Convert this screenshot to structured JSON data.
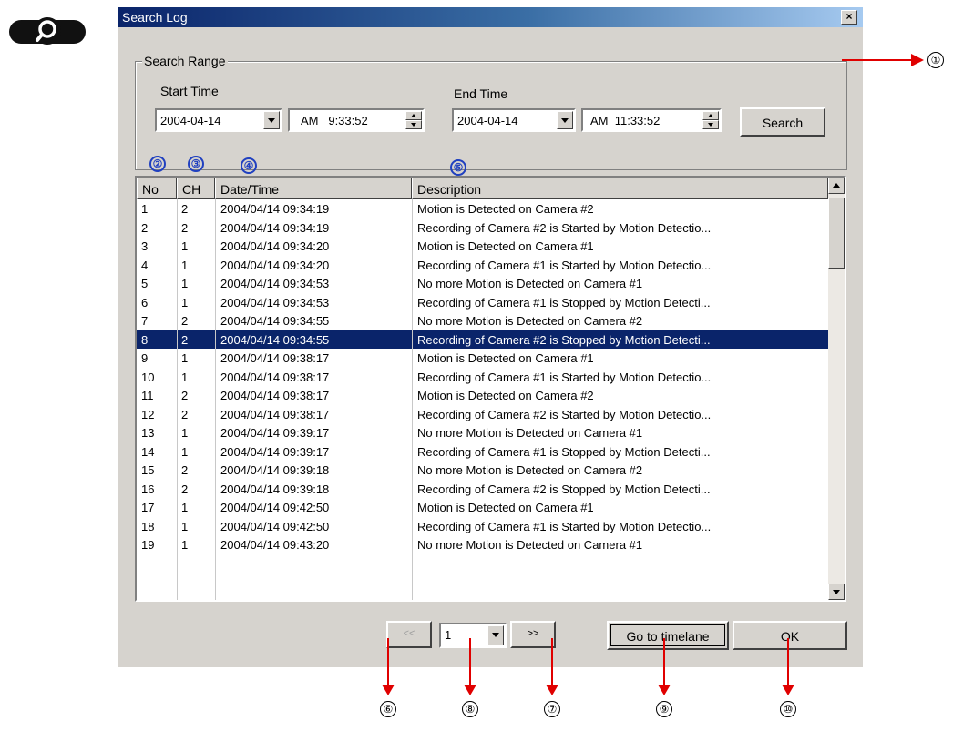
{
  "window": {
    "title": "Search Log",
    "close_glyph": "×"
  },
  "search_range": {
    "group_label": "Search Range",
    "start_label": "Start Time",
    "end_label": "End Time",
    "start_date": "2004-04-14",
    "start_time": "AM   9:33:52",
    "end_date": "2004-04-14",
    "end_time": "AM  11:33:52",
    "search_label": "Search"
  },
  "columns": [
    "No",
    "CH",
    "Date/Time",
    "Description"
  ],
  "rows": [
    [
      "1",
      "2",
      "2004/04/14 09:34:19",
      "Motion is Detected on Camera #2"
    ],
    [
      "2",
      "2",
      "2004/04/14 09:34:19",
      "Recording of Camera #2 is Started by Motion Detectio..."
    ],
    [
      "3",
      "1",
      "2004/04/14 09:34:20",
      "Motion is Detected on Camera #1"
    ],
    [
      "4",
      "1",
      "2004/04/14 09:34:20",
      "Recording of Camera #1 is Started by Motion Detectio..."
    ],
    [
      "5",
      "1",
      "2004/04/14 09:34:53",
      "No more Motion is Detected on Camera #1"
    ],
    [
      "6",
      "1",
      "2004/04/14 09:34:53",
      "Recording of Camera #1 is Stopped by Motion Detecti..."
    ],
    [
      "7",
      "2",
      "2004/04/14 09:34:55",
      "No more Motion is Detected on Camera #2"
    ],
    [
      "8",
      "2",
      "2004/04/14 09:34:55",
      "Recording of Camera #2 is Stopped by Motion Detecti..."
    ],
    [
      "9",
      "1",
      "2004/04/14 09:38:17",
      "Motion is Detected on Camera #1"
    ],
    [
      "10",
      "1",
      "2004/04/14 09:38:17",
      "Recording of Camera #1 is Started by Motion Detectio..."
    ],
    [
      "11",
      "2",
      "2004/04/14 09:38:17",
      "Motion is Detected on Camera #2"
    ],
    [
      "12",
      "2",
      "2004/04/14 09:38:17",
      "Recording of Camera #2 is Started by Motion Detectio..."
    ],
    [
      "13",
      "1",
      "2004/04/14 09:39:17",
      "No more Motion is Detected on Camera #1"
    ],
    [
      "14",
      "1",
      "2004/04/14 09:39:17",
      "Recording of Camera #1 is Stopped by Motion Detecti..."
    ],
    [
      "15",
      "2",
      "2004/04/14 09:39:18",
      "No more Motion is Detected on Camera #2"
    ],
    [
      "16",
      "2",
      "2004/04/14 09:39:18",
      "Recording of Camera #2 is Stopped by Motion Detecti..."
    ],
    [
      "17",
      "1",
      "2004/04/14 09:42:50",
      "Motion is Detected on Camera #1"
    ],
    [
      "18",
      "1",
      "2004/04/14 09:42:50",
      "Recording of Camera #1 is Started by Motion Detectio..."
    ],
    [
      "19",
      "1",
      "2004/04/14 09:43:20",
      "No more Motion is Detected on Camera #1"
    ]
  ],
  "selected_row": 8,
  "pager": {
    "prev": "<<",
    "page": "1",
    "next": ">>"
  },
  "buttons": {
    "goto": "Go to timelane",
    "ok": "OK"
  },
  "markers": {
    "m1": "①",
    "m2": "②",
    "m3": "③",
    "m4": "④",
    "m5": "⑤",
    "m6": "⑥",
    "m7": "⑦",
    "m8": "⑧",
    "m9": "⑨",
    "m10": "⑩"
  },
  "colors": {
    "title_bar": "#0a246a",
    "selection": "#0a246a",
    "annotation_arrow": "#e00000",
    "marker_blue": "#2040c0"
  },
  "icons": {
    "logo": "magnifier-icon"
  }
}
